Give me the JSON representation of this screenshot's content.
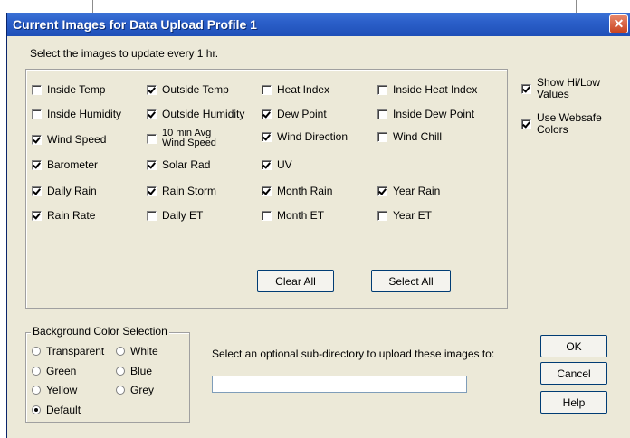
{
  "dialog": {
    "title": "Current Images for Data Upload Profile 1",
    "close_glyph": "✕",
    "prompt": "Select the images to update every 1 hr."
  },
  "images": {
    "inside_temp": {
      "label": "Inside Temp",
      "checked": false
    },
    "outside_temp": {
      "label": "Outside Temp",
      "checked": true
    },
    "heat_index": {
      "label": "Heat Index",
      "checked": false
    },
    "inside_heat_index": {
      "label": "Inside Heat Index",
      "checked": false
    },
    "inside_humidity": {
      "label": "Inside Humidity",
      "checked": false
    },
    "outside_humidity": {
      "label": "Outside Humidity",
      "checked": true
    },
    "dew_point": {
      "label": "Dew Point",
      "checked": true
    },
    "inside_dew_point": {
      "label": "Inside Dew Point",
      "checked": false
    },
    "wind_speed": {
      "label": "Wind Speed",
      "checked": true
    },
    "avg_wind_speed": {
      "label_line1": "10 min Avg",
      "label_line2": "Wind Speed",
      "checked": false
    },
    "wind_direction": {
      "label": "Wind Direction",
      "checked": true
    },
    "wind_chill": {
      "label": "Wind Chill",
      "checked": false
    },
    "barometer": {
      "label": "Barometer",
      "checked": true
    },
    "solar_rad": {
      "label": "Solar Rad",
      "checked": true
    },
    "uv": {
      "label": "UV",
      "checked": true
    },
    "daily_rain": {
      "label": "Daily Rain",
      "checked": true
    },
    "rain_storm": {
      "label": "Rain Storm",
      "checked": true
    },
    "month_rain": {
      "label": "Month Rain",
      "checked": true
    },
    "year_rain": {
      "label": "Year Rain",
      "checked": true
    },
    "rain_rate": {
      "label": "Rain Rate",
      "checked": true
    },
    "daily_et": {
      "label": "Daily ET",
      "checked": false
    },
    "month_et": {
      "label": "Month ET",
      "checked": false
    },
    "year_et": {
      "label": "Year ET",
      "checked": false
    }
  },
  "options": {
    "show_hilow": {
      "label_line1": "Show Hi/Low",
      "label_line2": "Values",
      "checked": true
    },
    "websafe": {
      "label_line1": "Use Websafe",
      "label_line2": "Colors",
      "checked": true
    }
  },
  "buttons": {
    "clear_all": "Clear All",
    "select_all": "Select All",
    "ok": "OK",
    "cancel": "Cancel",
    "help": "Help"
  },
  "background": {
    "title": "Background Color Selection",
    "options": {
      "transparent": {
        "label": "Transparent",
        "selected": false
      },
      "white": {
        "label": "White",
        "selected": false
      },
      "green": {
        "label": "Green",
        "selected": false
      },
      "blue": {
        "label": "Blue",
        "selected": false
      },
      "yellow": {
        "label": "Yellow",
        "selected": false
      },
      "grey": {
        "label": "Grey",
        "selected": false
      },
      "default": {
        "label": "Default",
        "selected": true
      }
    }
  },
  "subdir": {
    "label": "Select an optional sub-directory to upload these images to:",
    "value": ""
  },
  "colors": {
    "titlebar": "#2b5fc9",
    "dialog_bg": "#ece9d8",
    "close_button": "#c94420"
  }
}
